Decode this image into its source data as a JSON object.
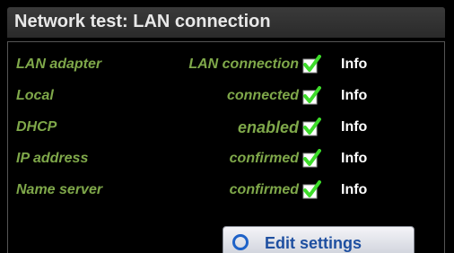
{
  "title": "Network test: LAN connection",
  "rows": [
    {
      "label": "LAN adapter",
      "value": "LAN connection",
      "checked": true,
      "info": "Info"
    },
    {
      "label": "Local",
      "value": "connected",
      "checked": true,
      "info": "Info"
    },
    {
      "label": "DHCP",
      "value": "enabled",
      "checked": true,
      "info": "Info"
    },
    {
      "label": "IP address",
      "value": "confirmed",
      "checked": true,
      "info": "Info"
    },
    {
      "label": "Name server",
      "value": "confirmed",
      "checked": true,
      "info": "Info"
    }
  ],
  "edit_button": {
    "label": "Edit settings",
    "icon": "circle-icon"
  },
  "colors": {
    "label_green": "#7fa84a",
    "check_green": "#3ddc2a",
    "button_text": "#1e4fa0",
    "info_text": "#ffffff"
  }
}
